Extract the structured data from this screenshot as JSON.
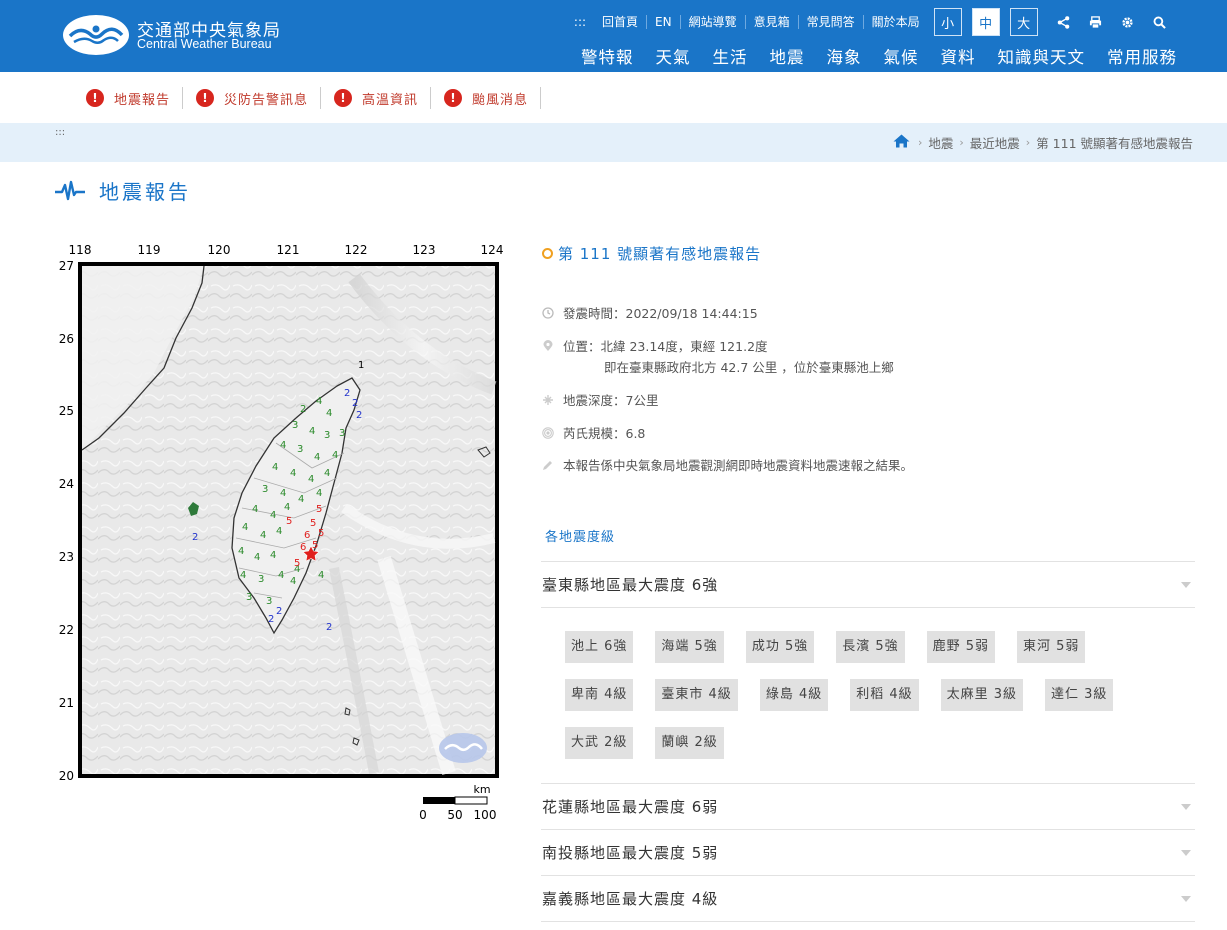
{
  "header": {
    "brand_zh": "交通部中央氣象局",
    "brand_en": "Central Weather Bureau",
    "skip_link": ":::",
    "top_links": [
      "回首頁",
      "EN",
      "網站導覽",
      "意見箱",
      "常見問答",
      "關於本局"
    ],
    "font_sizes": [
      "小",
      "中",
      "大"
    ],
    "font_size_selected": "中",
    "tool_icons": [
      "share-icon",
      "print-icon",
      "gear-icon",
      "search-icon"
    ],
    "main_nav": [
      "警特報",
      "天氣",
      "生活",
      "地震",
      "海象",
      "氣候",
      "資料",
      "知識與天文",
      "常用服務"
    ],
    "color": "#1a75c8"
  },
  "alerts": [
    {
      "label": "地震報告"
    },
    {
      "label": "災防告警訊息"
    },
    {
      "label": "高溫資訊"
    },
    {
      "label": "颱風消息"
    }
  ],
  "breadcrumb": {
    "skip_link": ":::",
    "items": [
      "地震",
      "最近地震",
      "第 111 號顯著有感地震報告"
    ]
  },
  "page_title": "地震報告",
  "map": {
    "x_ticks": [
      "118",
      "119",
      "120",
      "121",
      "122",
      "123",
      "124"
    ],
    "y_ticks": [
      "27",
      "26",
      "25",
      "24",
      "23",
      "22",
      "21",
      "20"
    ],
    "scale_unit": "km",
    "scale_labels": [
      "0",
      "50",
      "100"
    ],
    "isolated_label": "1"
  },
  "report": {
    "title": "第 111 號顯著有感地震報告",
    "time": "發震時間：2022/09/18 14:44:15",
    "location": "位置：北緯 23.14度，東經 121.2度",
    "location_note": "即在臺東縣政府北方 42.7 公里 ，位於臺東縣池上鄉",
    "depth": "地震深度：7公里",
    "magnitude": "芮氏規模：6.8",
    "note": "本報告係中央氣象局地震觀測網即時地震資料地震速報之結果。"
  },
  "intensity": {
    "heading": "各地震度級",
    "regions": [
      {
        "label": "臺東縣地區最大震度 6強",
        "stations": [
          "池上 6強",
          "海端 5強",
          "成功 5強",
          "長濱 5強",
          "鹿野 5弱",
          "東河 5弱",
          "卑南 4級",
          "臺東市 4級",
          "綠島 4級",
          "利稻 4級",
          "太麻里 3級",
          "達仁 3級",
          "大武 2級",
          "蘭嶼 2級"
        ]
      },
      {
        "label": "花蓮縣地區最大震度 6弱"
      },
      {
        "label": "南投縣地區最大震度 5弱"
      },
      {
        "label": "嘉義縣地區最大震度 4級"
      }
    ]
  }
}
